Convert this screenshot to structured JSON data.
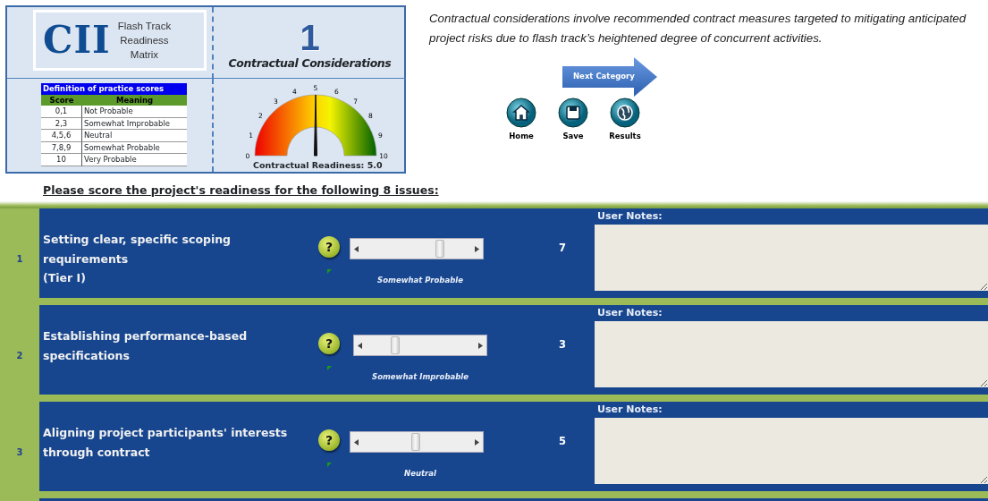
{
  "header": {
    "logo": "CII",
    "app_title": [
      "Flash Track",
      "Readiness",
      "Matrix"
    ],
    "category_number": "1",
    "category_title": "Contractual Considerations"
  },
  "score_table": {
    "title": "Definition of practice scores",
    "columns": [
      "Score",
      "Meaning"
    ],
    "rows": [
      [
        "0,1",
        "Not Probable"
      ],
      [
        "2,3",
        "Somewhat Improbable"
      ],
      [
        "4,5,6",
        "Neutral"
      ],
      [
        "7,8,9",
        "Somewhat Probable"
      ],
      [
        "10",
        "Very Probable"
      ]
    ]
  },
  "gauge": {
    "ticks": [
      "0",
      "1",
      "2",
      "3",
      "4",
      "5",
      "6",
      "7",
      "8",
      "9",
      "10"
    ],
    "level": 0.5,
    "caption": "Contractual Readiness: 5.0"
  },
  "description": "Contractual considerations involve recommended contract measures targeted to mitigating anticipated project risks due to flash track’s heightened degree of concurrent activities.",
  "next_button": "Next Category",
  "nav_buttons": [
    {
      "kind": "home",
      "label": "Home"
    },
    {
      "kind": "save",
      "label": "Save"
    },
    {
      "kind": "results",
      "label": "Results"
    }
  ],
  "instruction": "Please score the project's readiness for the following 8 issues:",
  "issues": [
    {
      "number": "1",
      "lines": [
        "Setting clear, specific scoping",
        "requirements",
        "(Tier I)"
      ],
      "help": "?",
      "level": 0.7,
      "score": "7",
      "meaning": "Somewhat Probable",
      "notes_label": "User Notes:"
    },
    {
      "number": "2",
      "lines": [
        "Establishing performance-based",
        "specifications"
      ],
      "help": "?",
      "level": 0.3,
      "score": "3",
      "meaning": "Somewhat Improbable",
      "notes_label": "User Notes:"
    },
    {
      "number": "3",
      "lines": [
        "Aligning project participants' interests",
        "through contract"
      ],
      "help": "?",
      "level": 0.5,
      "score": "5",
      "meaning": "Neutral",
      "notes_label": "User Notes:"
    }
  ]
}
